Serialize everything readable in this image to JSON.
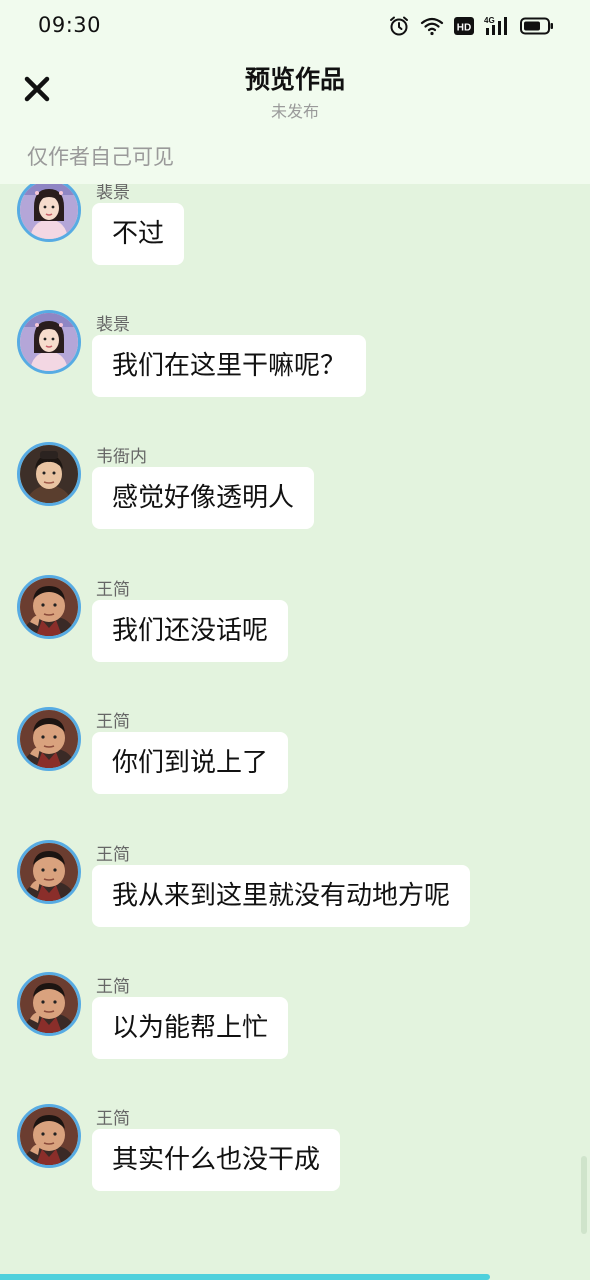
{
  "status_bar": {
    "time": "09:30",
    "icons": [
      "alarm-icon",
      "wifi-icon",
      "hd-icon",
      "signal-4g-icon",
      "battery-icon"
    ],
    "hd_label": "HD",
    "network_label": "4G"
  },
  "header": {
    "close_icon": "close-icon",
    "title": "预览作品",
    "subtitle": "未发布",
    "visibility_note": "仅作者自己可见"
  },
  "messages": [
    {
      "sender": "裴景",
      "text": "不过",
      "avatar": "pei-jing"
    },
    {
      "sender": "裴景",
      "text": "我们在这里干嘛呢？",
      "avatar": "pei-jing"
    },
    {
      "sender": "韦衙内",
      "text": "感觉好像透明人",
      "avatar": "wei-yanei"
    },
    {
      "sender": "王简",
      "text": "我们还没话呢",
      "avatar": "wang-jian"
    },
    {
      "sender": "王简",
      "text": "你们到说上了",
      "avatar": "wang-jian"
    },
    {
      "sender": "王简",
      "text": "我从来到这里就没有动地方呢",
      "avatar": "wang-jian"
    },
    {
      "sender": "王简",
      "text": "以为能帮上忙",
      "avatar": "wang-jian"
    },
    {
      "sender": "王简",
      "text": "其实什么也没干成",
      "avatar": "wang-jian"
    }
  ],
  "progress": {
    "fraction": 0.83
  },
  "colors": {
    "header_bg": "#f1fbee",
    "chat_bg": "#e3f3de",
    "avatar_border": "#57abe3",
    "progress_fill": "#4fd0dc"
  }
}
